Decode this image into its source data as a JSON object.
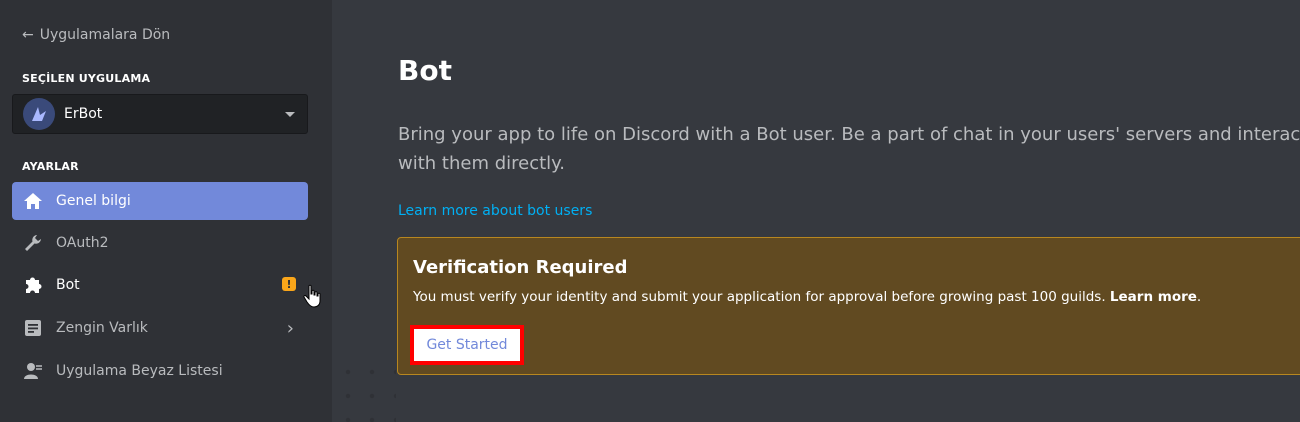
{
  "sidebar": {
    "back_label": "Uygulamalara Dön",
    "selected_app_heading": "SEÇİLEN UYGULAMA",
    "selected_app_name": "ErBot",
    "settings_heading": "AYARLAR",
    "items": [
      {
        "label": "Genel bilgi",
        "icon": "home-icon",
        "active": true
      },
      {
        "label": "OAuth2",
        "icon": "wrench-icon"
      },
      {
        "label": "Bot",
        "icon": "puzzle-icon",
        "badge": "!"
      },
      {
        "label": "Zengin Varlık",
        "icon": "document-icon"
      },
      {
        "label": "Uygulama Beyaz Listesi",
        "icon": "user-whitelist-icon"
      }
    ]
  },
  "main": {
    "title": "Bot",
    "description": "Bring your app to life on Discord with a Bot user. Be a part of chat in your users' servers and interact with them directly.",
    "learn_more_link": "Learn more about bot users",
    "verification": {
      "title": "Verification Required",
      "text": "You must verify your identity and submit your application for approval before growing past 100 guilds.",
      "learn_more": "Learn more",
      "button_label": "Get Started"
    }
  },
  "colors": {
    "accent": "#7289da",
    "warning_bg": "#614a21",
    "warning_border": "#b8871f",
    "link": "#00b0f4",
    "highlight": "#ff0000"
  }
}
